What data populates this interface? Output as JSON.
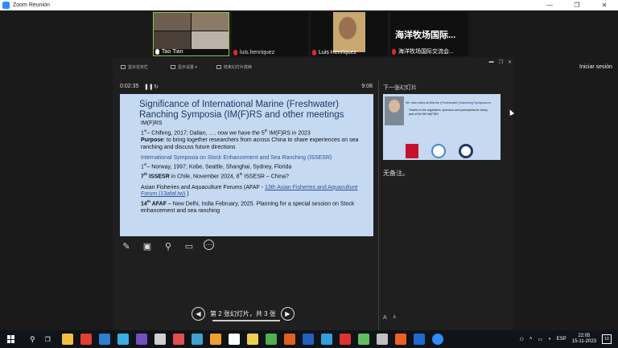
{
  "window": {
    "title": "Zoom Reunión",
    "controls": [
      "—",
      "❐",
      "✕"
    ]
  },
  "participants": [
    {
      "name": "Tao Tian",
      "muted": false
    },
    {
      "name": "luis.henriquez",
      "muted": true
    },
    {
      "name": "Luis Henríquez",
      "muted": true
    },
    {
      "name": "海洋牧场国际交流会...",
      "display_name": "海洋牧场国际...",
      "muted": true
    }
  ],
  "share": {
    "start_label": "Iniciar sesión"
  },
  "presenter": {
    "toolbar": [
      "显示任务栏",
      "显示设置 ▾",
      "结束幻灯片放映"
    ],
    "elapsed": "0:02:35",
    "pause_icon": "❚❚",
    "reset_icon": "↻",
    "clock": "9:08",
    "next_label": "下一张幻灯片",
    "notes": "无备注。",
    "font_up": "A",
    "font_down": "A",
    "nav_label": "第 2 张幻灯片，共 3 张"
  },
  "slide": {
    "title": "Significance of International Marine (Freshwater) Ranching Symposia (IM(F)RS and other meetings",
    "block1": {
      "line1": "IM(F)RS",
      "line2a": "1",
      "line2sup": "st",
      "line2b": "– Chifeng, 2017; Dalian, …. now we have the 5",
      "line2sup2": "th",
      "line2c": " IM(F)RS in 2023",
      "purpose_label": "Purpose",
      "purpose_text": ": to bring together researchers from across China to share experiences on sea ranching and discuss future directions"
    },
    "block2": {
      "line1": "International Symposia on Stock Enhancement and Sea Ranching (ISSESR)",
      "line2a": "1",
      "line2sup": "st",
      "line2b": "– Norway, 1997; Kobe, Seattle, Shanghai, Sydney, Florida",
      "line3a": "7",
      "line3sup": "th",
      "line3b": " ISSESR",
      "line3c": " in Chile, November 2024, 8",
      "line3sup2": "th",
      "line3d": " ISSESR – China?"
    },
    "block3": {
      "line1a": "Asian Fisheries and Aquaculture Forums (AFAF - ",
      "link": "13th Asian Fisheries and Aquaculture Forum (13afaf.tw)",
      "line1b": " )",
      "line2a": "14",
      "line2sup": "th",
      "line2b": " AFAF",
      "line2c": " – New Delhi, India February, 2025. Planning for a special session on Stock enhancement and sea ranching"
    }
  },
  "next_slide": {
    "title": "5th International Marine (Freshwater) Ranching Symposium",
    "text": "Thanks to the organisers, sponsors and participants for being part of the 5th IM(F)RS"
  },
  "taskbar": {
    "lang": "ESP",
    "time": "22:05",
    "date": "15-11-2023",
    "notif_count": "10",
    "icon_colors": [
      "#f0c040",
      "#e04030",
      "#2d7fd0",
      "#3ab0e0",
      "#7050c0",
      "#d0d0d0",
      "#e05050",
      "#40a0d0",
      "#f0a030",
      "#ffffff",
      "#f0d050",
      "#50b050",
      "#e06020",
      "#2060c0",
      "#30a0e0",
      "#e03030",
      "#60c060",
      "#c0c0c0",
      "#f06020",
      "#1e6ad0",
      "#2d8cff"
    ]
  }
}
